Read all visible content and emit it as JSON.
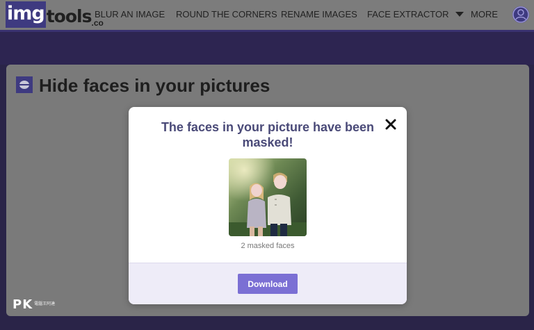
{
  "nav": {
    "logo_img": "img",
    "logo_tools": "tools",
    "logo_co": ".co",
    "items": [
      {
        "label": "BLUR AN IMAGE"
      },
      {
        "label": "ROUND THE CORNERS"
      },
      {
        "label": "RENAME IMAGES"
      },
      {
        "label": "FACE EXTRACTOR"
      }
    ],
    "more_label": "MORE",
    "icons": {
      "more": "caret-down-icon",
      "account": "user-account-icon"
    }
  },
  "page": {
    "title": "Hide faces in your pictures",
    "title_icon": "face-mask-icon"
  },
  "modal": {
    "title": "The faces in your picture have been masked!",
    "close_icon": "close-icon",
    "masked_faces_text": "2 masked faces",
    "download_label": "Download"
  },
  "watermark": {
    "logo_text": "PK",
    "brand_text": "電腦王阿達"
  },
  "colors": {
    "accent": "#7b6fd4",
    "brand_dark": "#3e3a80",
    "modal_title": "#4a4a78",
    "overlay_band": "#2d2551"
  }
}
